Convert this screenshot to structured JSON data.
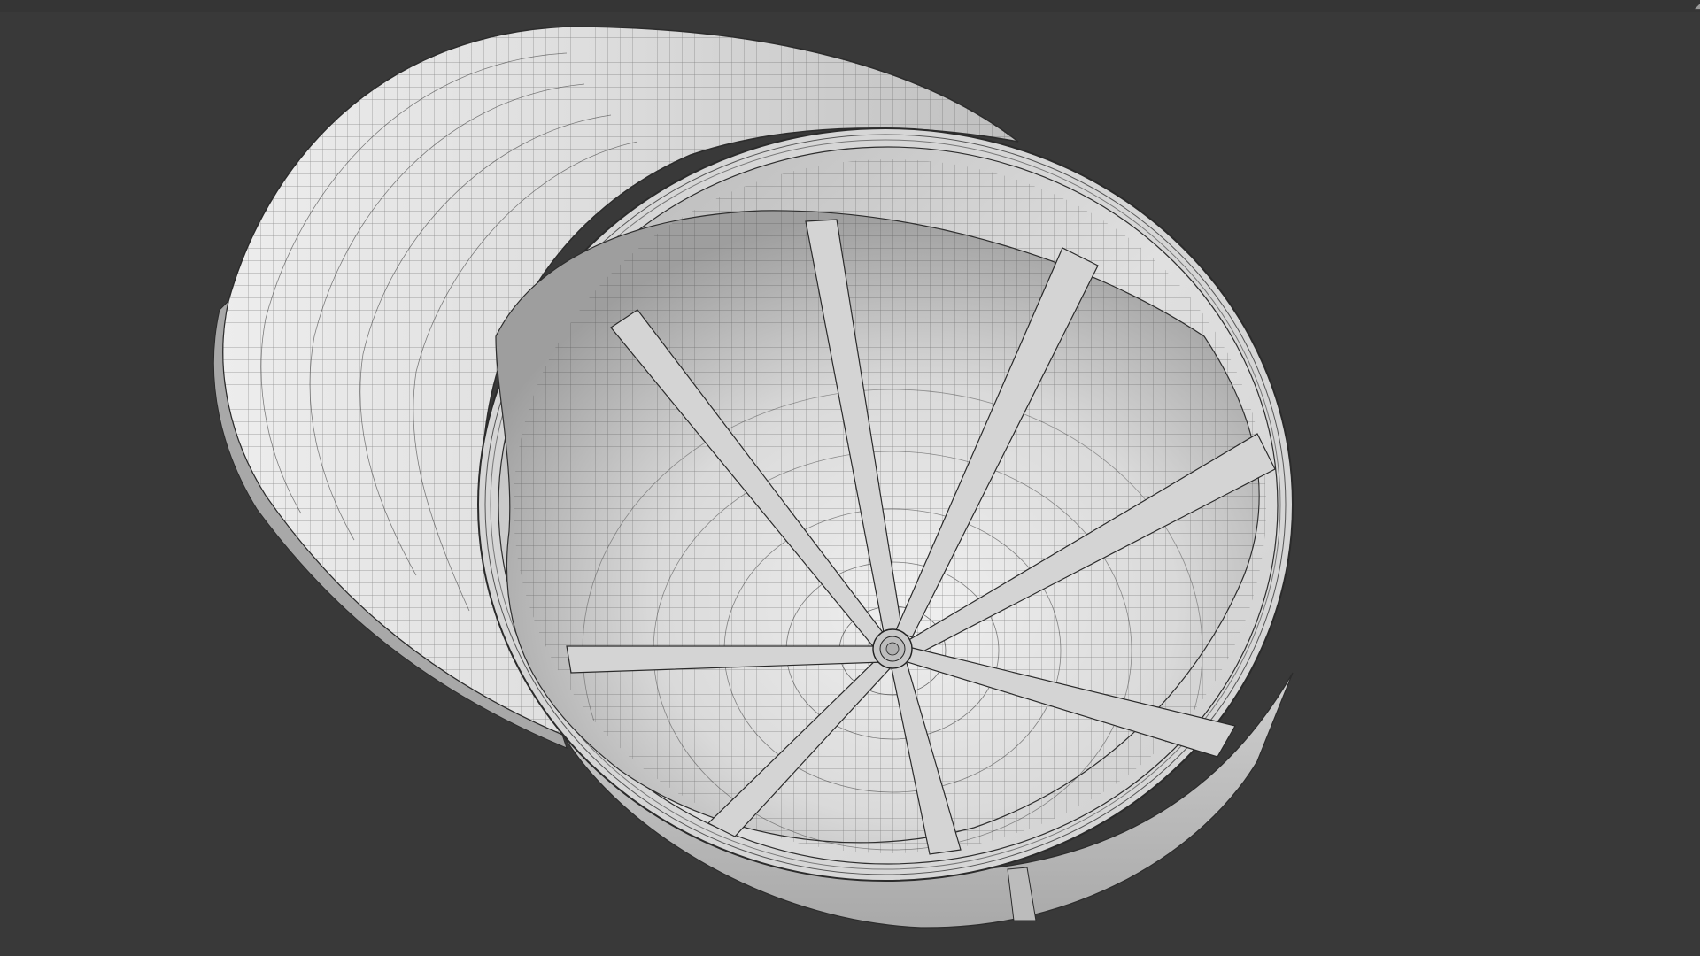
{
  "viewport": {
    "background_color": "#393939",
    "top_strip_color": "#353535"
  },
  "model": {
    "shading": "solid",
    "overlay": "wireframe",
    "surface_color": "#c9c9c9",
    "wire_color": "#2f2f2f"
  },
  "icons": {
    "corner_handle": "corner-handle-icon"
  }
}
